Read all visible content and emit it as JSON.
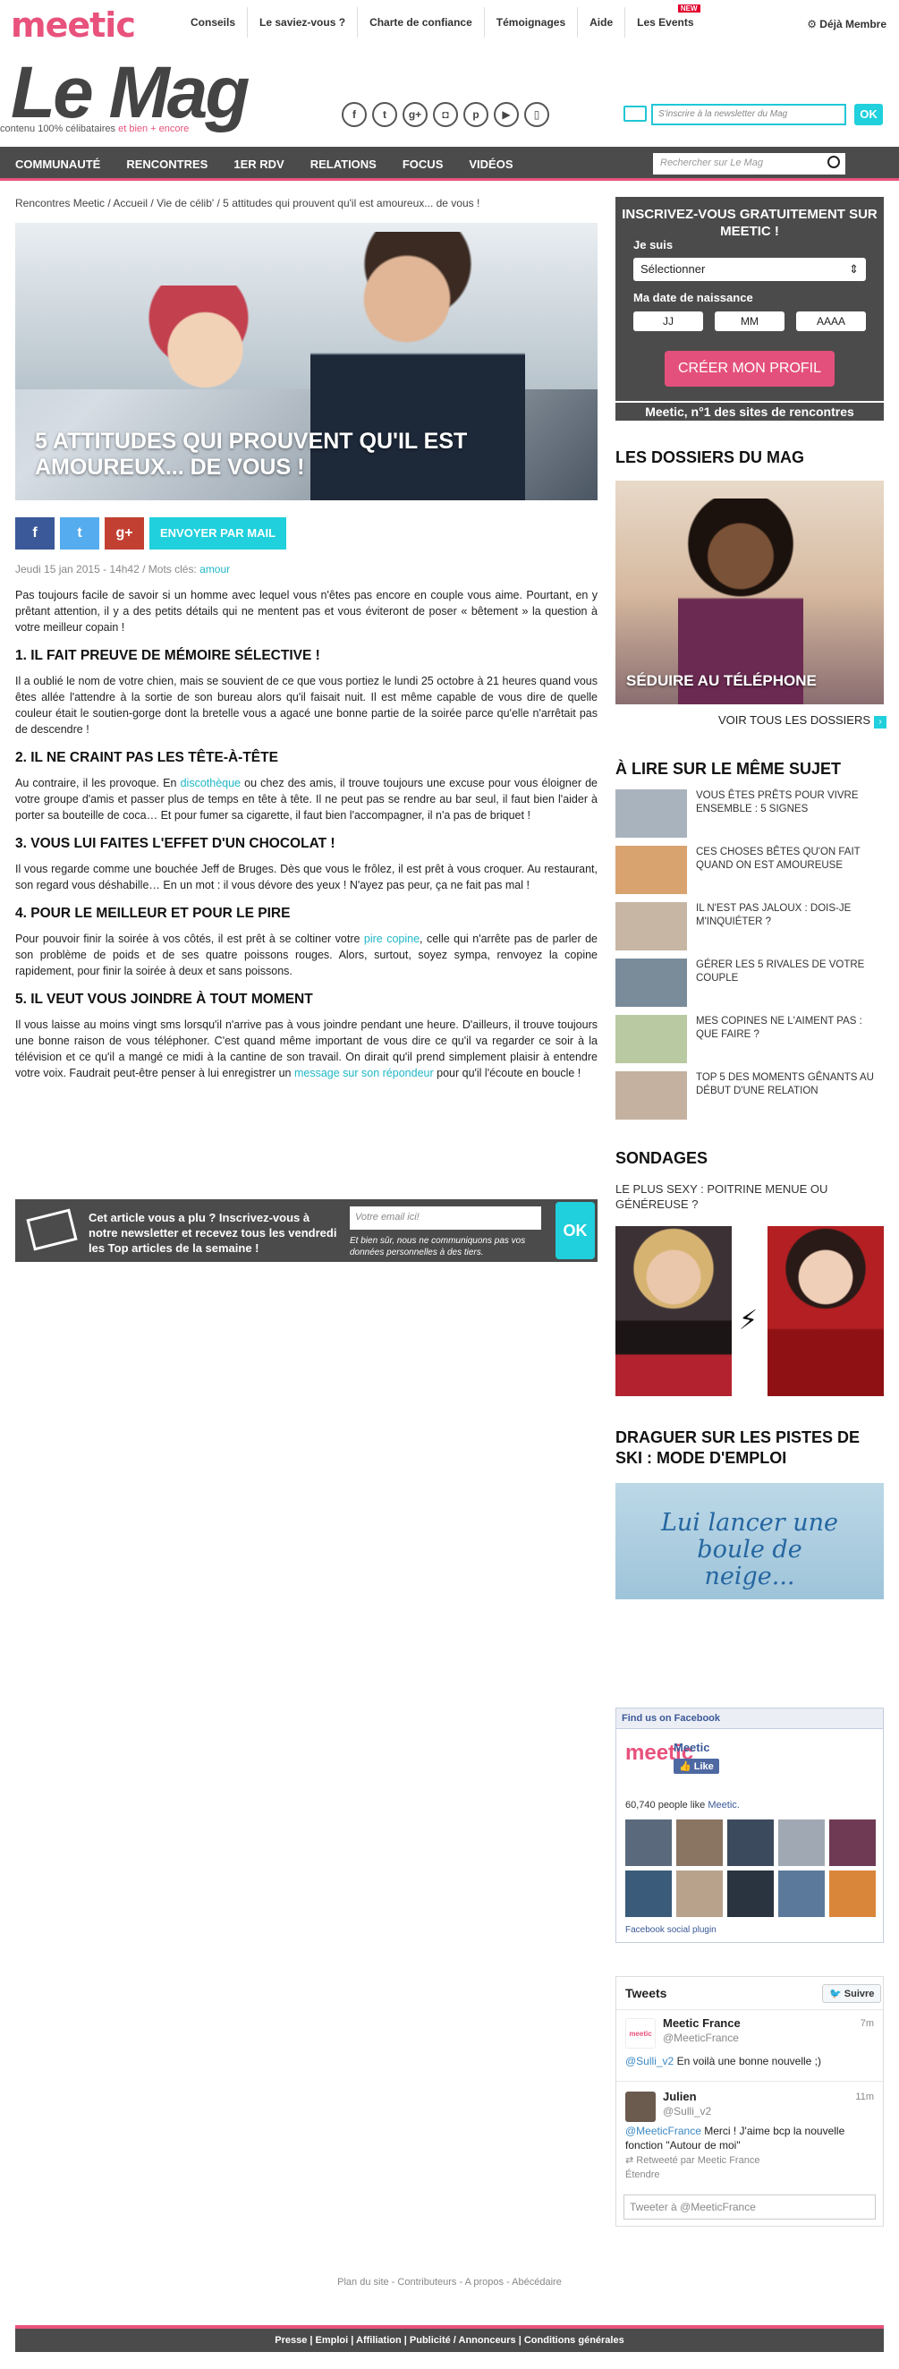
{
  "brand": {
    "logo": "meetic"
  },
  "topnav": {
    "items": [
      "Conseils",
      "Le saviez-vous ?",
      "Charte de confiance",
      "Témoignages",
      "Aide",
      "Les Events"
    ],
    "new_badge": "NEW",
    "member_link": "Déjà Membre"
  },
  "masthead": {
    "title": "Le Mag",
    "tagline_start": "contenu 100% célibataires",
    "tagline_pink": "et bien + encore",
    "newsletter_placeholder": "S'inscrire à la newsletter du Mag",
    "newsletter_ok": "OK"
  },
  "mainnav": {
    "items": [
      "COMMUNAUTÉ",
      "RENCONTRES",
      "1ER RDV",
      "RELATIONS",
      "FOCUS",
      "VIDÉOS"
    ],
    "search_placeholder": "Rechercher sur Le Mag"
  },
  "breadcrumb": "Rencontres Meetic / Accueil / Vie de célib' / 5 attitudes qui prouvent qu'il est amoureux... de vous !",
  "article": {
    "title": "5 attitudes qui prouvent qu'il est amoureux... de vous !",
    "share_mail": "ENVOYER PAR MAIL",
    "meta_date": "Jeudi 15 jan 2015 - 14h42 / Mots clés:",
    "meta_keyword": "amour",
    "intro": "Pas toujours facile de savoir si un homme avec lequel vous n'êtes pas encore en couple vous aime. Pourtant, en y prêtant attention, il y a des petits détails qui ne mentent pas et vous éviteront de poser « bêtement » la question à votre meilleur copain !",
    "h1": "1. IL FAIT PREUVE DE MÉMOIRE SÉLECTIVE !",
    "p1": "Il a oublié le nom de votre chien, mais se souvient de ce que vous portiez le lundi 25 octobre à 21 heures quand vous êtes allée l'attendre à la sortie de son bureau alors qu'il faisait nuit. Il est même capable de vous dire de quelle couleur était le soutien-gorge dont la bretelle vous a agacé une bonne partie de la soirée parce qu'elle n'arrêtait pas de descendre !",
    "h2": "2. IL NE CRAINT PAS LES TÊTE-À-TÊTE",
    "p2_a": "Au contraire, il les provoque. En",
    "p2_link": "discothèque",
    "p2_b": "ou chez des amis, il trouve toujours une excuse pour vous éloigner de votre groupe d'amis et passer plus de temps en tête à tête. Il ne peut pas se rendre au bar seul, il faut bien l'aider à porter sa bouteille de coca… Et pour fumer sa cigarette, il faut bien l'accompagner, il n'a pas de briquet !",
    "h3": "3. VOUS LUI FAITES L'EFFET D'UN CHOCOLAT !",
    "p3": "Il vous regarde comme une bouchée Jeff de Bruges. Dès que vous le frôlez, il est prêt à vous croquer. Au restaurant, son regard vous déshabille… En un mot : il vous dévore des yeux ! N'ayez pas peur, ça ne fait pas mal !",
    "h4": "4. POUR LE MEILLEUR ET POUR LE PIRE",
    "p4_a": "Pour pouvoir finir la soirée à vos côtés, il est prêt à se coltiner votre",
    "p4_link": "pire copine",
    "p4_b": ", celle qui n'arrête pas de parler de son problème de poids et de ses quatre poissons rouges. Alors, surtout, soyez sympa, renvoyez la copine rapidement, pour finir la soirée à deux et sans poissons.",
    "h5": "5. IL VEUT VOUS JOINDRE À TOUT MOMENT",
    "p5_a": "Il vous laisse au moins vingt sms lorsqu'il n'arrive pas à vous joindre pendant une heure. D'ailleurs, il trouve toujours une bonne raison de vous téléphoner. C'est quand même important de vous dire ce qu'il va regarder ce soir à la télévision et ce qu'il a mangé ce midi à la cantine de son travail. On dirait qu'il prend simplement plaisir à entendre votre voix. Faudrait peut-être penser à lui enregistrer un",
    "p5_link": "message sur son répondeur",
    "p5_b": "pour qu'il l'écoute en boucle !"
  },
  "newsletter_box": {
    "text": "Cet article vous a plu ? Inscrivez-vous à notre newsletter et recevez tous les vendredi les Top articles de la semaine !",
    "placeholder": "Votre email ici!",
    "legal": "Et bien sûr, nous ne communiquons pas vos données personnelles à des tiers.",
    "ok": "OK"
  },
  "signup": {
    "title": "INSCRIVEZ-VOUS GRATUITEMENT SUR MEETIC !",
    "je_suis": "Je suis",
    "select_value": "Sélectionner",
    "birth_label": "Ma date de naissance",
    "jj": "JJ",
    "mm": "MM",
    "aaaa": "AAAA",
    "cta": "CRÉER MON PROFIL",
    "footer": "Meetic, n°1 des sites de rencontres"
  },
  "dossiers": {
    "heading": "LES DOSSIERS DU MAG",
    "caption": "SÉDUIRE AU TÉLÉPHONE",
    "voir_tous": "VOIR TOUS LES DOSSIERS"
  },
  "related": {
    "heading": "À LIRE SUR LE MÊME SUJET",
    "items": [
      "VOUS ÊTES PRÊTS POUR VIVRE ENSEMBLE : 5 SIGNES",
      "CES CHOSES BÊTES QU'ON FAIT QUAND ON EST AMOUREUSE",
      "IL N'EST PAS JALOUX : DOIS-JE M'INQUIÉTER ?",
      "GÉRER LES 5 RIVALES DE VOTRE COUPLE",
      "MES COPINES NE L'AIMENT PAS : QUE FAIRE ?",
      "TOP 5 DES MOMENTS GÊNANTS AU DÉBUT D'UNE RELATION"
    ],
    "thumb_colors": [
      "#a9b3be",
      "#d9a370",
      "#c7b6a3",
      "#7a8c9a",
      "#b9c9a2",
      "#c4b19f"
    ]
  },
  "sondage": {
    "heading": "SONDAGES",
    "question": "LE PLUS SEXY : POITRINE MENUE OU GÉNÉREUSE ?"
  },
  "ski": {
    "heading": "DRAGUER SUR LES PISTES DE SKI : MODE D'EMPLOI",
    "image_text": "Lui lancer une boule de neige..."
  },
  "facebook": {
    "header": "Find us on Facebook",
    "page_name": "Meetic",
    "page_logo": "meetic",
    "like": "Like",
    "count_text": "60,740 people like",
    "count_link": "Meetic.",
    "grid_colors": [
      "#5a6a7c",
      "#8a7462",
      "#3c4a5e",
      "#a0a8b3",
      "#6f3b54",
      "#3b5b7a",
      "#b8a28c",
      "#2a3440",
      "#5b7a9b",
      "#d9863a"
    ],
    "footer": "Facebook social plugin"
  },
  "twitter": {
    "heading": "Tweets",
    "follow": "Suivre",
    "t1_name": "Meetic France",
    "t1_handle": "@MeeticFrance",
    "t1_time": "7m",
    "t1_mention": "@Sulli_v2",
    "t1_text": "En voilà une bonne nouvelle ;)",
    "t2_name": "Julien",
    "t2_handle": "@Sulli_v2",
    "t2_time": "11m",
    "t2_mention": "@MeeticFrance",
    "t2_text": "Merci ! J'aime bcp la nouvelle fonction \"Autour de moi\"",
    "t2_retweet": "Retweeté par Meetic France",
    "t2_expand": "Étendre",
    "compose_placeholder": "Tweeter à @MeeticFrance"
  },
  "footer": {
    "links": "Plan du site -  Contributeurs -  A propos -  Abécédaire",
    "bar": "Presse | Emploi | Affiliation | Publicité / Annonceurs | Conditions générales"
  }
}
